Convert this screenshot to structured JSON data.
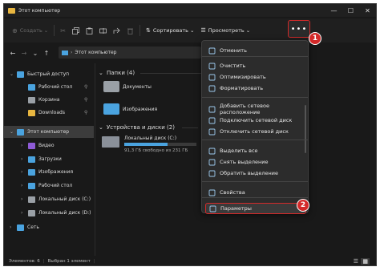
{
  "window": {
    "title": "Этот компьютер",
    "controls": [
      "—",
      "☐",
      "✕"
    ]
  },
  "toolbar": {
    "create_label": "Создать",
    "sort_label": "Сортировать",
    "view_label": "Просмотреть",
    "more_label": "•••"
  },
  "address": {
    "path": "Этот компьютер"
  },
  "sidebar": {
    "items": [
      {
        "label": "Быстрый доступ",
        "icon": "star-icon",
        "color": "#4aa3df",
        "level": 0,
        "chevron": "⌄"
      },
      {
        "label": "Рабочий стол",
        "icon": "desktop-icon",
        "color": "#4aa3df",
        "level": 1,
        "pin": "📌"
      },
      {
        "label": "Корзина",
        "icon": "recycle-bin-icon",
        "color": "#9aa0a6",
        "level": 1,
        "pin": "📌"
      },
      {
        "label": "Downloads",
        "icon": "folder-icon",
        "color": "#e8b640",
        "level": 1,
        "pin": "📌"
      },
      {
        "label": "Этот компьютер",
        "icon": "computer-icon",
        "color": "#4aa3df",
        "level": 0,
        "chevron": "⌄"
      },
      {
        "label": "Видео",
        "icon": "video-icon",
        "color": "#8e5bd6",
        "level": 1,
        "chevron": "›"
      },
      {
        "label": "Загрузки",
        "icon": "download-icon",
        "color": "#4aa3df",
        "level": 1,
        "chevron": "›"
      },
      {
        "label": "Изображения",
        "icon": "pictures-icon",
        "color": "#4aa3df",
        "level": 1,
        "chevron": "›"
      },
      {
        "label": "Рабочий стол",
        "icon": "desktop-icon",
        "color": "#4aa3df",
        "level": 1,
        "chevron": "›"
      },
      {
        "label": "Локальный диск (C:)",
        "icon": "drive-icon",
        "color": "#9aa0a6",
        "level": 1,
        "chevron": "›"
      },
      {
        "label": "Локальный диск (D:)",
        "icon": "drive-icon",
        "color": "#9aa0a6",
        "level": 1,
        "chevron": "›"
      },
      {
        "label": "Сеть",
        "icon": "network-icon",
        "color": "#4aa3df",
        "level": 0,
        "chevron": "›"
      }
    ]
  },
  "content": {
    "folders_header": "Папки (4)",
    "folders": [
      {
        "label": "Документы",
        "color": "#9aa0a6"
      },
      {
        "label": "Изображения",
        "color": "#4aa3df"
      }
    ],
    "drives_header": "Устройства и диски (2)",
    "drive": {
      "label": "Локальный диск (C:)",
      "size": "91,3 ГБ свободно из 231 ГБ",
      "used_fraction": 0.6
    }
  },
  "menu": {
    "items": [
      {
        "label": "Отменить",
        "icon": "undo-icon"
      },
      {
        "label": "Очистить",
        "icon": "broom-icon"
      },
      {
        "label": "Оптимизировать",
        "icon": "optimize-icon"
      },
      {
        "label": "Форматировать",
        "icon": "format-icon"
      },
      {
        "label": "Добавить сетевое расположение",
        "icon": "network-location-icon"
      },
      {
        "label": "Подключить сетевой диск",
        "icon": "map-drive-icon"
      },
      {
        "label": "Отключить сетевой диск",
        "icon": "disconnect-drive-icon"
      },
      {
        "label": "Выделить все",
        "icon": "select-all-icon"
      },
      {
        "label": "Снять выделение",
        "icon": "select-none-icon"
      },
      {
        "label": "Обратить выделение",
        "icon": "invert-selection-icon"
      },
      {
        "label": "Свойства",
        "icon": "properties-icon"
      },
      {
        "label": "Параметры",
        "icon": "options-icon"
      }
    ]
  },
  "badges": {
    "one": "1",
    "two": "2"
  },
  "status": {
    "elements": "Элементов: 6",
    "selected": "Выбран 1 элемент"
  },
  "colors": {
    "accent": "#d32a2a",
    "folder": "#e8b640",
    "blue": "#4aa3df"
  }
}
